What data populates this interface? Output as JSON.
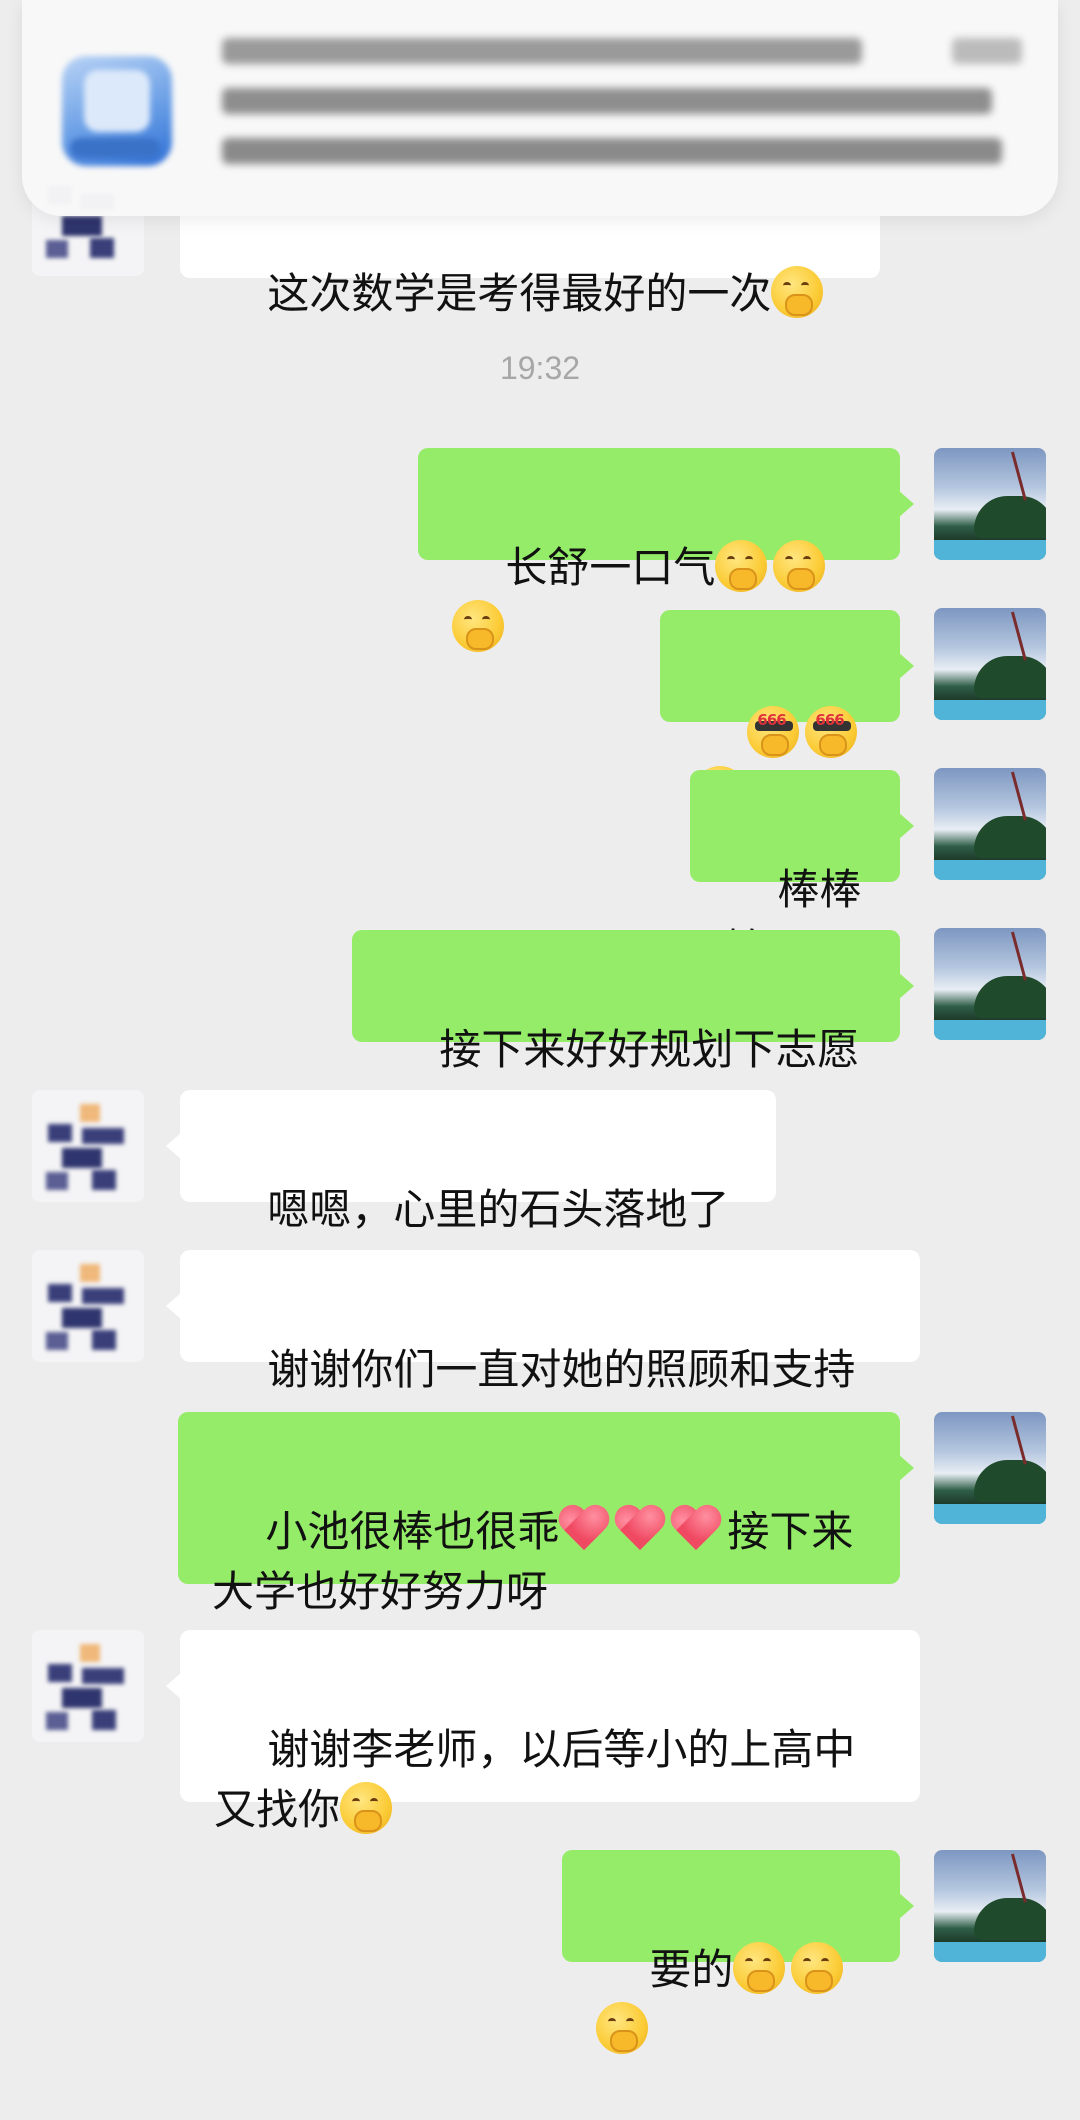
{
  "chat": {
    "partial_message_top": "这次数学是考得最好的一次",
    "timestamp": "19:32",
    "messages": [
      {
        "sender": "me",
        "text": "长舒一口气",
        "emoji": "thinking-face-emoji x3"
      },
      {
        "sender": "me",
        "text": "",
        "emoji": "666-sunglasses-emoji x3",
        "emoji_label": "666"
      },
      {
        "sender": "me",
        "text": "棒棒棒"
      },
      {
        "sender": "me",
        "text": "接下来好好规划下志愿"
      },
      {
        "sender": "them",
        "text": "嗯嗯，心里的石头落地了"
      },
      {
        "sender": "them",
        "text": "谢谢你们一直对她的照顾和支持"
      },
      {
        "sender": "me",
        "text_a": "小池很棒也很乖",
        "text_b": "接下来",
        "text_c": "大学也好好努力呀",
        "emoji": "red-heart-emoji x3"
      },
      {
        "sender": "them",
        "text_a": "谢谢李老师，以后等小的上高中",
        "text_b": "又找你",
        "emoji": "thinking-face-emoji"
      },
      {
        "sender": "me",
        "text": "要的",
        "emoji": "thinking-face-emoji x3"
      }
    ]
  },
  "colors": {
    "background": "#ededed",
    "bubble_me": "#95ec69",
    "bubble_them": "#ffffff",
    "timestamp": "#a7a7a7"
  }
}
